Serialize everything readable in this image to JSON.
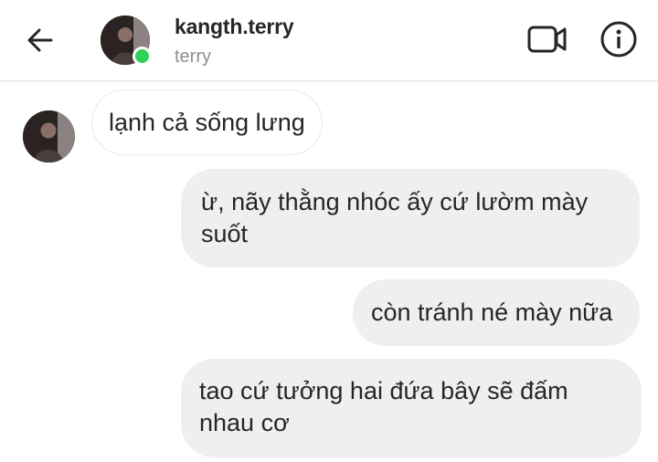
{
  "header": {
    "username": "kangth.terry",
    "subname": "terry",
    "online_color": "#2fd15a",
    "back_icon": "arrow-left-icon",
    "video_icon": "video-camera-icon",
    "info_icon": "info-icon"
  },
  "messages": [
    {
      "direction": "incoming",
      "text": "lạnh cả sống lưng"
    },
    {
      "direction": "outgoing",
      "text": "ừ, nãy thằng nhóc ấy cứ lườm mày suốt"
    },
    {
      "direction": "outgoing",
      "text": "còn tránh né mày nữa"
    },
    {
      "direction": "outgoing",
      "text": "tao cứ tưởng hai đứa bây sẽ đấm nhau cơ"
    }
  ],
  "colors": {
    "outgoing_bubble": "#efefef",
    "incoming_border": "#e8e8e8",
    "text": "#262626",
    "subtext": "#8e8e8e"
  }
}
